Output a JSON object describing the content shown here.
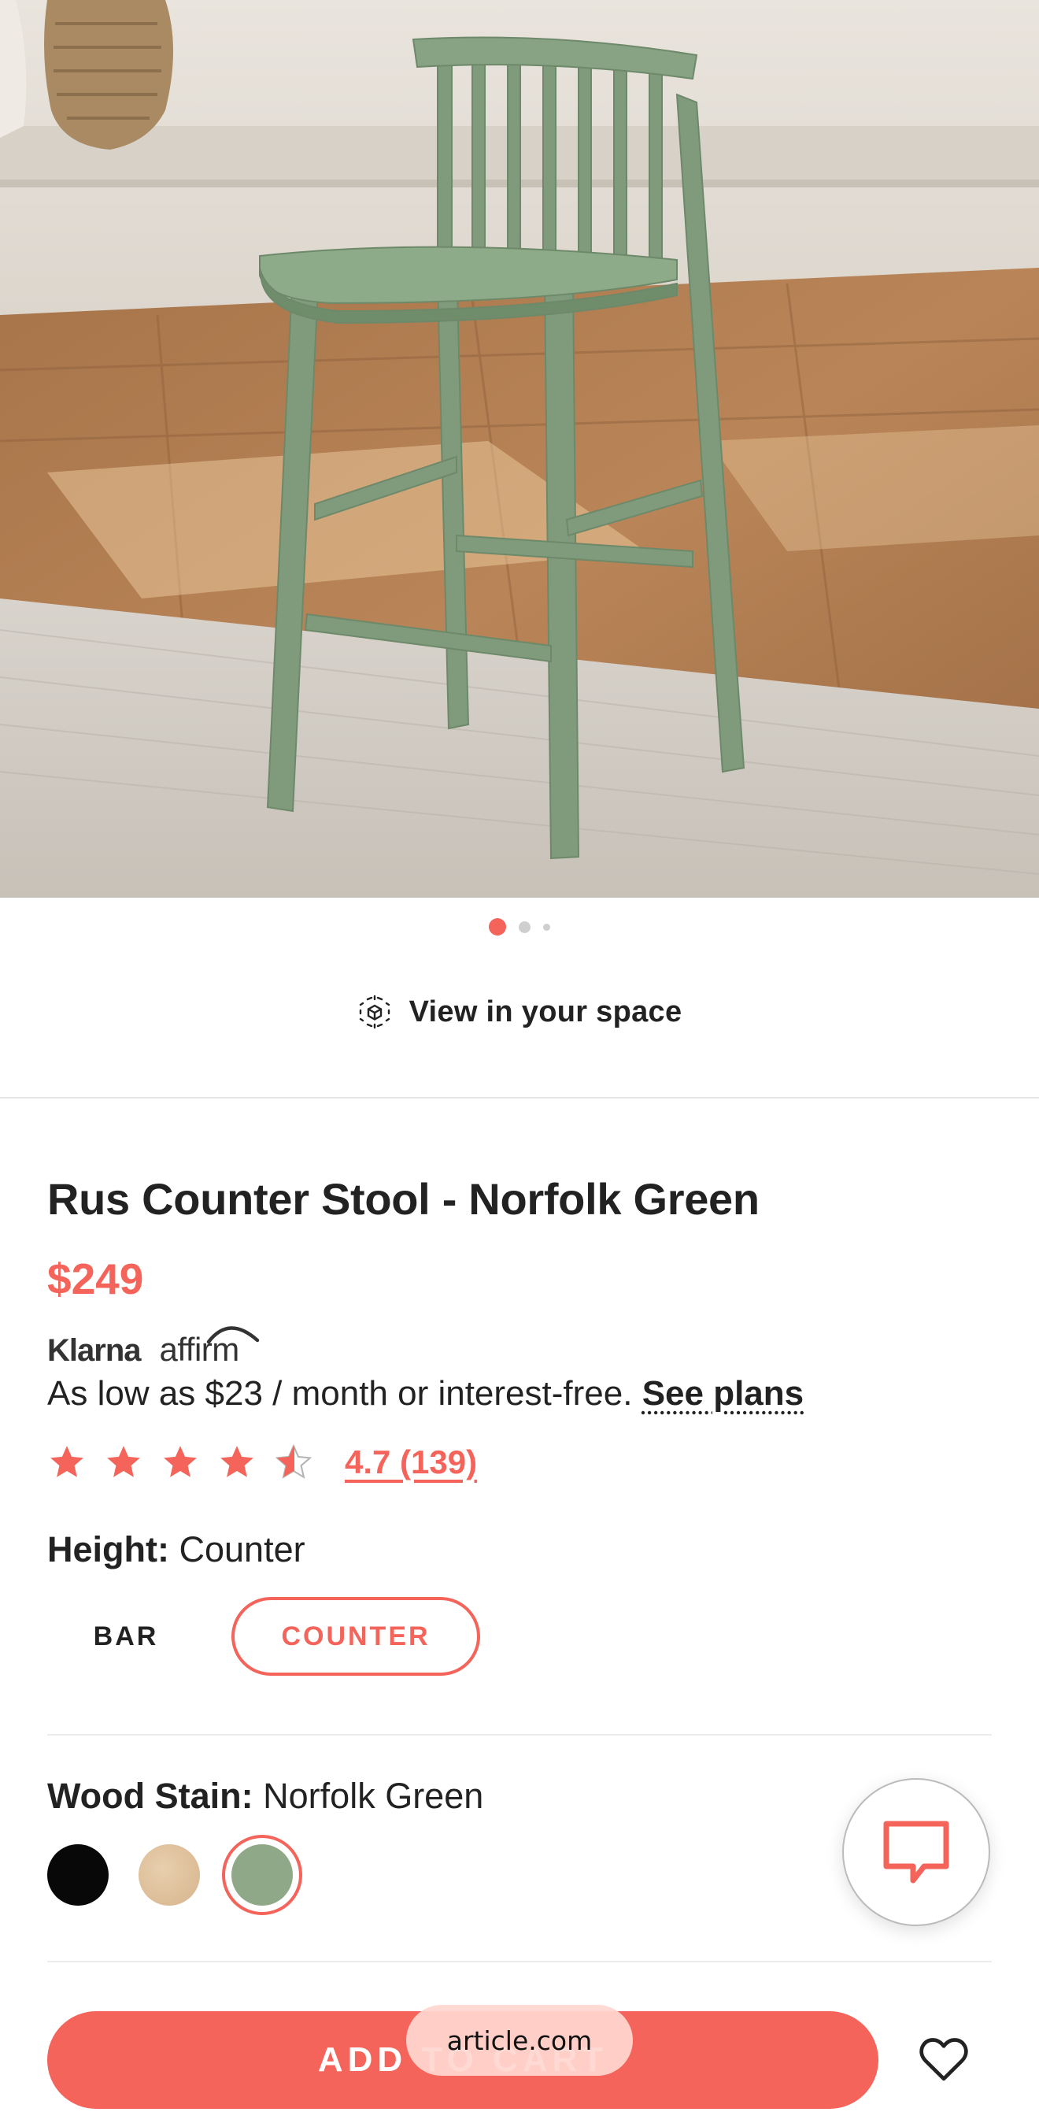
{
  "gallery": {
    "dots": 3,
    "active_index": 0,
    "image_alt": "green spindle-back counter stool on a rug"
  },
  "view_in_space": {
    "label": "View in your space",
    "icon": "ar-cube-icon"
  },
  "product": {
    "title": "Rus Counter Stool - Norfolk Green",
    "price": "$249"
  },
  "financing": {
    "klarna": "Klarna",
    "affirm": "affirm",
    "text": "As low as $23 / month or interest-free.",
    "link": "See plans"
  },
  "rating": {
    "value": 4.7,
    "max": 5,
    "label": "4.7 (139)"
  },
  "height": {
    "label": "Height:",
    "selected": "Counter",
    "options": [
      "BAR",
      "COUNTER"
    ]
  },
  "wood_stain": {
    "label": "Wood Stain:",
    "selected": "Norfolk Green",
    "swatches": [
      {
        "name": "black",
        "color": "#080808"
      },
      {
        "name": "natural",
        "color": "#dcbf99"
      },
      {
        "name": "norfolk-green",
        "color": "#8fa988"
      }
    ]
  },
  "cta": {
    "add_label": "ADD TO CART"
  },
  "browser": {
    "url": "article.com"
  },
  "colors": {
    "accent": "#f4645a",
    "text": "#222222",
    "stool_green": "#7f9b7b"
  },
  "icons": {
    "chat": "chat-bubble-icon",
    "favorite": "heart-icon"
  }
}
